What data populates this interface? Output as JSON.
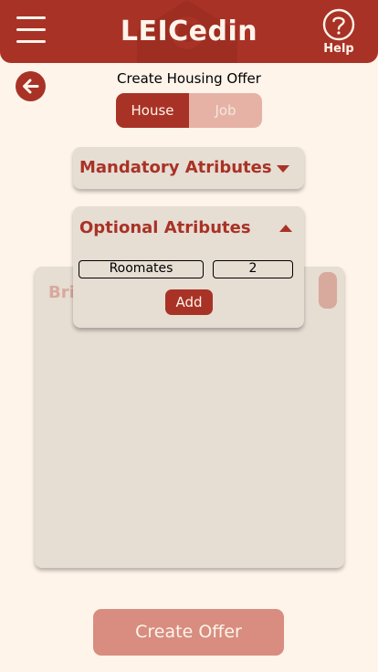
{
  "header": {
    "app_title": "LEICedin",
    "help_label": "Help",
    "menu_icon": "hamburger-menu-icon",
    "help_icon": "question-circle-icon"
  },
  "page": {
    "title": "Create Housing Offer",
    "back_icon": "arrow-left-icon"
  },
  "toggle": {
    "options": [
      "House",
      "Job"
    ],
    "selected": "House"
  },
  "mandatory": {
    "title": "Mandatory Atributes",
    "expanded": false
  },
  "optional": {
    "title": "Optional Atributes",
    "expanded": true,
    "attribute_name": "Roomates",
    "attribute_value": "2",
    "add_label": "Add"
  },
  "brief": {
    "label": "Bri"
  },
  "create_button": "Create Offer",
  "colors": {
    "primary": "#a93226",
    "background": "#fef4ea",
    "panel": "#e6ddd3",
    "inactive": "#e6b2a6",
    "disabled_button": "#d88d80"
  }
}
